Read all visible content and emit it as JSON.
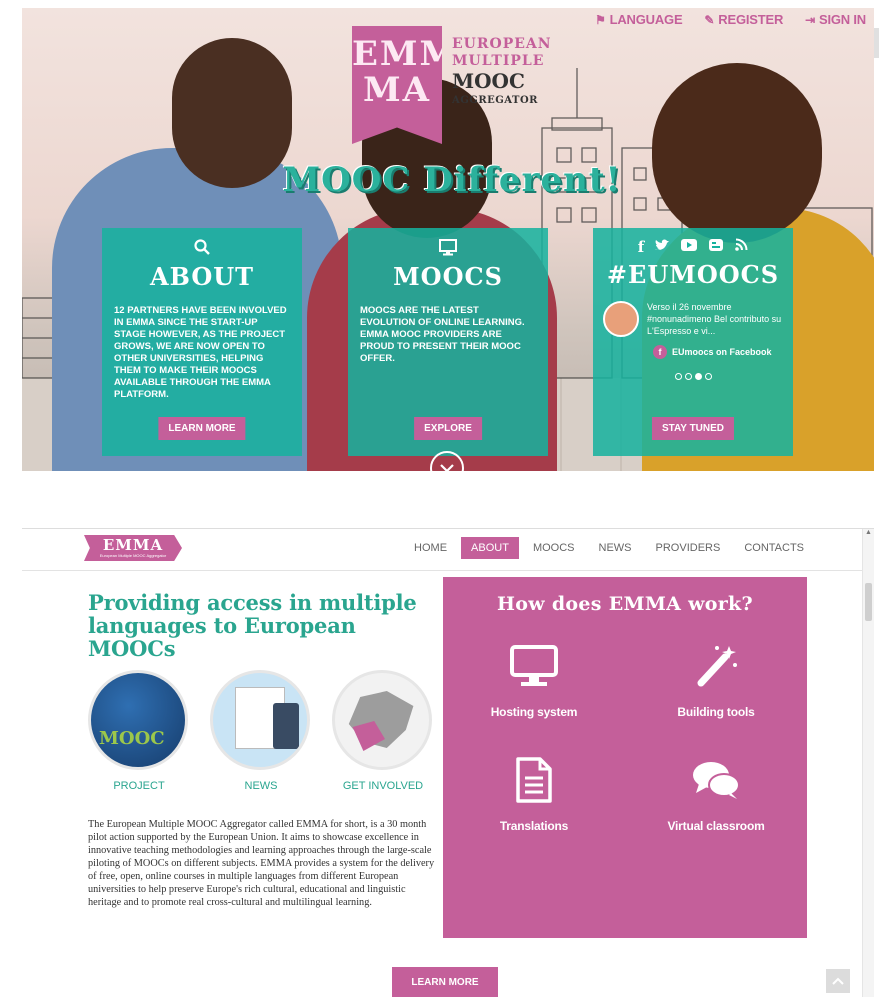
{
  "hero": {
    "topnav": [
      {
        "icon": "flag-icon",
        "glyph": "⚑",
        "label": "LANGUAGE"
      },
      {
        "icon": "edit-icon",
        "glyph": "✎",
        "label": "REGISTER"
      },
      {
        "icon": "sign-in-icon",
        "glyph": "⇥",
        "label": "SIGN IN"
      }
    ],
    "logo": {
      "badge_line1": "EMM",
      "badge_line2": "MA",
      "text_line1": "EUROPEAN",
      "text_line2": "MULTIPLE",
      "text_line3": "MOOC",
      "text_line4": "AGGREGATOR"
    },
    "slogan": "MOOC Different!",
    "panels": {
      "about": {
        "title": "ABOUT",
        "icon": "search-icon",
        "text": "12 partners have been involved in EMMA since the start-up stage however, as the project grows, we are now open to other universities, helping them to make their MOOCs available through the EMMA platform.",
        "button": "LEARN MORE"
      },
      "moocs": {
        "title": "MOOCS",
        "icon": "monitor-icon",
        "text": "MOOCs are the latest evolution of online learning. EMMA MOOC providers are proud to present their MOOC offer.",
        "button": "EXPLORE"
      },
      "eumoocs": {
        "title": "#EUMOOCS",
        "social_icons": [
          "facebook-icon",
          "twitter-icon",
          "youtube-icon",
          "blog-icon",
          "rss-icon"
        ],
        "tweet": "Verso il 26 novembre #nonunadimeno Bel contributo su L'Espresso e vi...",
        "facebook_label": "EUmoocs on Facebook",
        "button": "STAY TUNED",
        "slider_active": 2,
        "slider_count": 4
      }
    }
  },
  "site": {
    "logo_text": "EMMA",
    "logo_small": "European Multiple MOOC Aggregator",
    "menu": [
      {
        "label": "HOME",
        "active": false
      },
      {
        "label": "ABOUT",
        "active": true
      },
      {
        "label": "MOOCS",
        "active": false
      },
      {
        "label": "NEWS",
        "active": false
      },
      {
        "label": "PROVIDERS",
        "active": false
      },
      {
        "label": "CONTACTS",
        "active": false
      }
    ],
    "heading": "Providing access in multiple languages to European MOOCs",
    "circles": [
      {
        "label": "PROJECT",
        "image_text": "MOOC"
      },
      {
        "label": "NEWS"
      },
      {
        "label": "GET INVOLVED"
      }
    ],
    "description": "The European Multiple MOOC Aggregator called EMMA for short, is a 30 month pilot action supported by the European Union. It aims to showcase excellence in innovative teaching methodologies and learning approaches through the large-scale piloting of MOOCs on different subjects. EMMA provides a system for the delivery of free, open, online courses in multiple languages from different European universities to help preserve Europe's rich cultural, educational and linguistic heritage and to promote real cross-cultural and multilingual learning.",
    "how": {
      "title": "How does EMMA work?",
      "features": [
        {
          "label": "Hosting system",
          "icon": "monitor-icon"
        },
        {
          "label": "Building tools",
          "icon": "magic-wand-icon"
        },
        {
          "label": "Translations",
          "icon": "document-icon"
        },
        {
          "label": "Virtual classroom",
          "icon": "chat-bubbles-icon"
        }
      ]
    },
    "learn_more": "LEARN MORE"
  },
  "colors": {
    "brand_pink": "#c45f9a",
    "brand_teal": "#2aa58f",
    "panel_teal": "#16b29e"
  }
}
